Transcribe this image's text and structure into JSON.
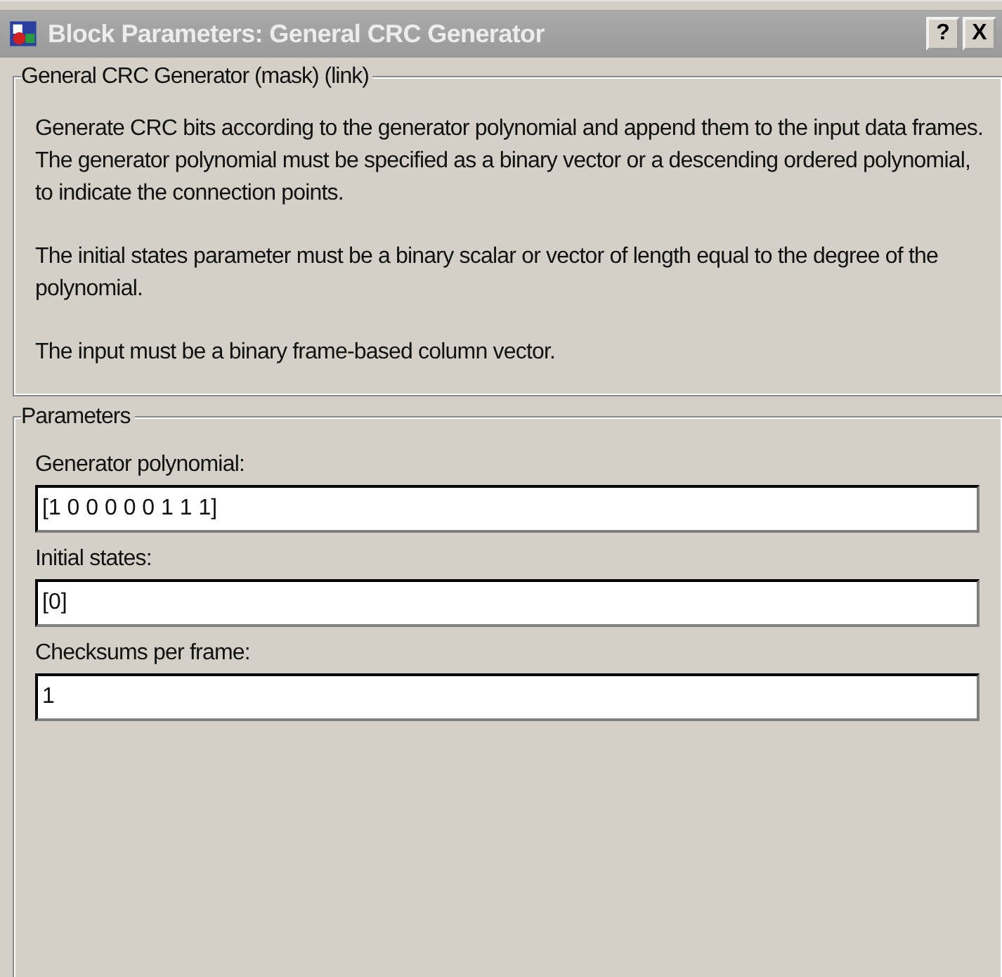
{
  "window": {
    "title": "Block Parameters: General CRC Generator",
    "buttons": [
      "?",
      "X"
    ]
  },
  "description": {
    "legend": "General CRC Generator (mask) (link)",
    "paragraphs": [
      "Generate CRC bits according to the generator polynomial and append them to the input data frames. The generator polynomial must be specified as a binary vector or a descending ordered polynomial, to indicate the connection points.",
      "The initial states parameter must be a binary scalar or vector of length equal to the degree of the polynomial.",
      "The input must be a binary frame-based column vector."
    ]
  },
  "parameters": {
    "legend": "Parameters",
    "fields": [
      {
        "label": "Generator polynomial:",
        "value": "[1 0 0 0 0 0 1 1 1]"
      },
      {
        "label": "Initial states:",
        "value": "[0]"
      },
      {
        "label": "Checksums per frame:",
        "value": "1"
      }
    ]
  }
}
